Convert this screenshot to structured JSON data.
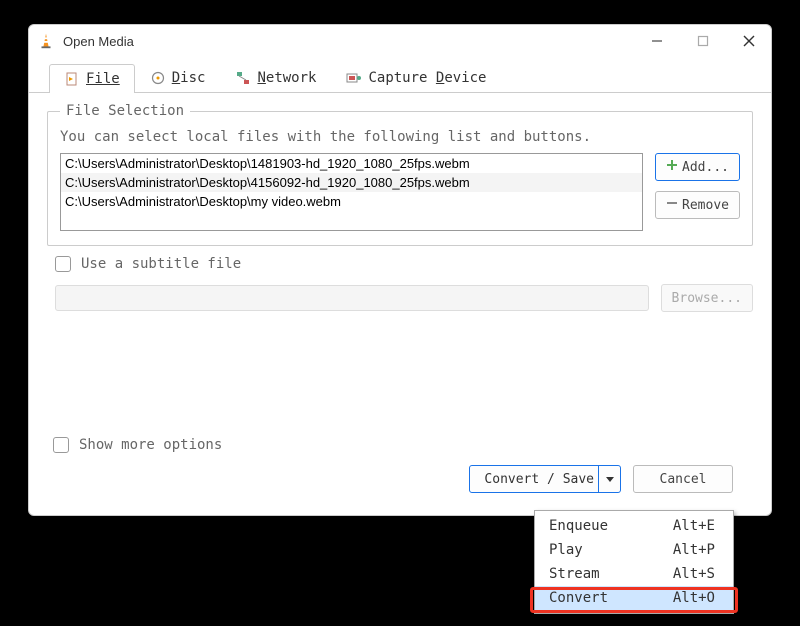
{
  "window": {
    "title": "Open Media"
  },
  "tabs": {
    "file": "File",
    "disc": "Disc",
    "network": "Network",
    "capture": "Capture Device"
  },
  "file_selection": {
    "legend": "File Selection",
    "hint": "You can select local files with the following list and buttons.",
    "items": [
      "C:\\Users\\Administrator\\Desktop\\1481903-hd_1920_1080_25fps.webm",
      "C:\\Users\\Administrator\\Desktop\\4156092-hd_1920_1080_25fps.webm",
      "C:\\Users\\Administrator\\Desktop\\my video.webm"
    ],
    "add_label": "Add...",
    "remove_label": "Remove"
  },
  "subtitle": {
    "label": "Use a subtitle file",
    "browse_label": "Browse..."
  },
  "more_options_label": "Show more options",
  "footer": {
    "convert_label": "Convert / Save",
    "cancel_label": "Cancel"
  },
  "dropdown": {
    "items": [
      {
        "label": "Enqueue",
        "accel": "Alt+E"
      },
      {
        "label": "Play",
        "accel": "Alt+P"
      },
      {
        "label": "Stream",
        "accel": "Alt+S"
      },
      {
        "label": "Convert",
        "accel": "Alt+O"
      }
    ]
  }
}
